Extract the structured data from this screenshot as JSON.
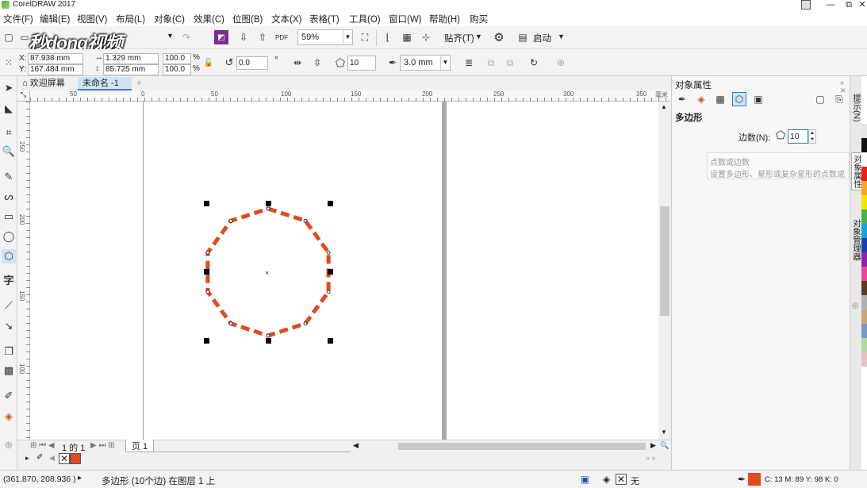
{
  "window": {
    "title": "CorelDRAW 2017",
    "min": "—",
    "restore": "⧉",
    "close": "✕"
  },
  "menu": [
    "文件(F)",
    "编辑(E)",
    "视图(V)",
    "布局(L)",
    "对象(C)",
    "效果(C)",
    "位图(B)",
    "文本(X)",
    "表格(T)",
    "工具(O)",
    "窗口(W)",
    "帮助(H)",
    "购买"
  ],
  "watermark": "秒dong视频",
  "toolbar1": {
    "zoom": "59%",
    "snap_label": "贴齐(T)",
    "launch_label": "启动"
  },
  "toolbar2": {
    "x_label": "X:",
    "x_value": "87.938 mm",
    "y_label": "Y:",
    "y_value": "167.484 mm",
    "w_value": "1.329 mm",
    "h_value": "85.725 mm",
    "scale_x": "100.0",
    "scale_y": "100.0",
    "pct1": "%",
    "pct2": "%",
    "rotation": "0.0",
    "degree": "°",
    "sides": "10",
    "outline_width": "3.0 mm"
  },
  "tabs": {
    "welcome": "欢迎屏幕",
    "document": "未命名 -1",
    "add": "+"
  },
  "ruler": {
    "h_ticks": [
      "50",
      "0",
      "50",
      "100",
      "150",
      "200",
      "250",
      "300",
      "350"
    ],
    "v_ticks": [
      "250",
      "200",
      "150",
      "100"
    ],
    "unit": "毫米"
  },
  "page_nav": {
    "counter": "1 的 1",
    "page_tab": "页 1"
  },
  "docker": {
    "title": "对象属性",
    "section": "多边形",
    "sides_label": "边数(N):",
    "sides_value": "10",
    "tooltip_title": "点数或边数",
    "tooltip_body": "设置多边形、星形或复杂星形的点数或"
  },
  "docker_tabs": [
    "提示(N)",
    "对象属性",
    "对象管理器"
  ],
  "status": {
    "coords": "(361.870, 208.936 )",
    "arrow": "▸",
    "description": "多边形 (10个边) 在图层 1 上",
    "fill_none": "无",
    "color_info": "C: 13 M: 89 Y: 98 K: 0"
  },
  "colors": {
    "outline": "#e04a1f",
    "accent": "#2f7fd1",
    "selected": "#cfe3f7"
  },
  "palette_colors": [
    "#e6e6e6",
    "#111111",
    "#ffffff",
    "#e8211f",
    "#f5a623",
    "#f2e600",
    "#4caf50",
    "#19a3d6",
    "#1b3fb3",
    "#8e24aa",
    "#ec4899",
    "#5c3c1e",
    "#b0b0b0",
    "#c7a77a",
    "#7a9ac2",
    "#b3d7a1",
    "#e6c2c2"
  ],
  "polygon": {
    "sides": 10
  }
}
